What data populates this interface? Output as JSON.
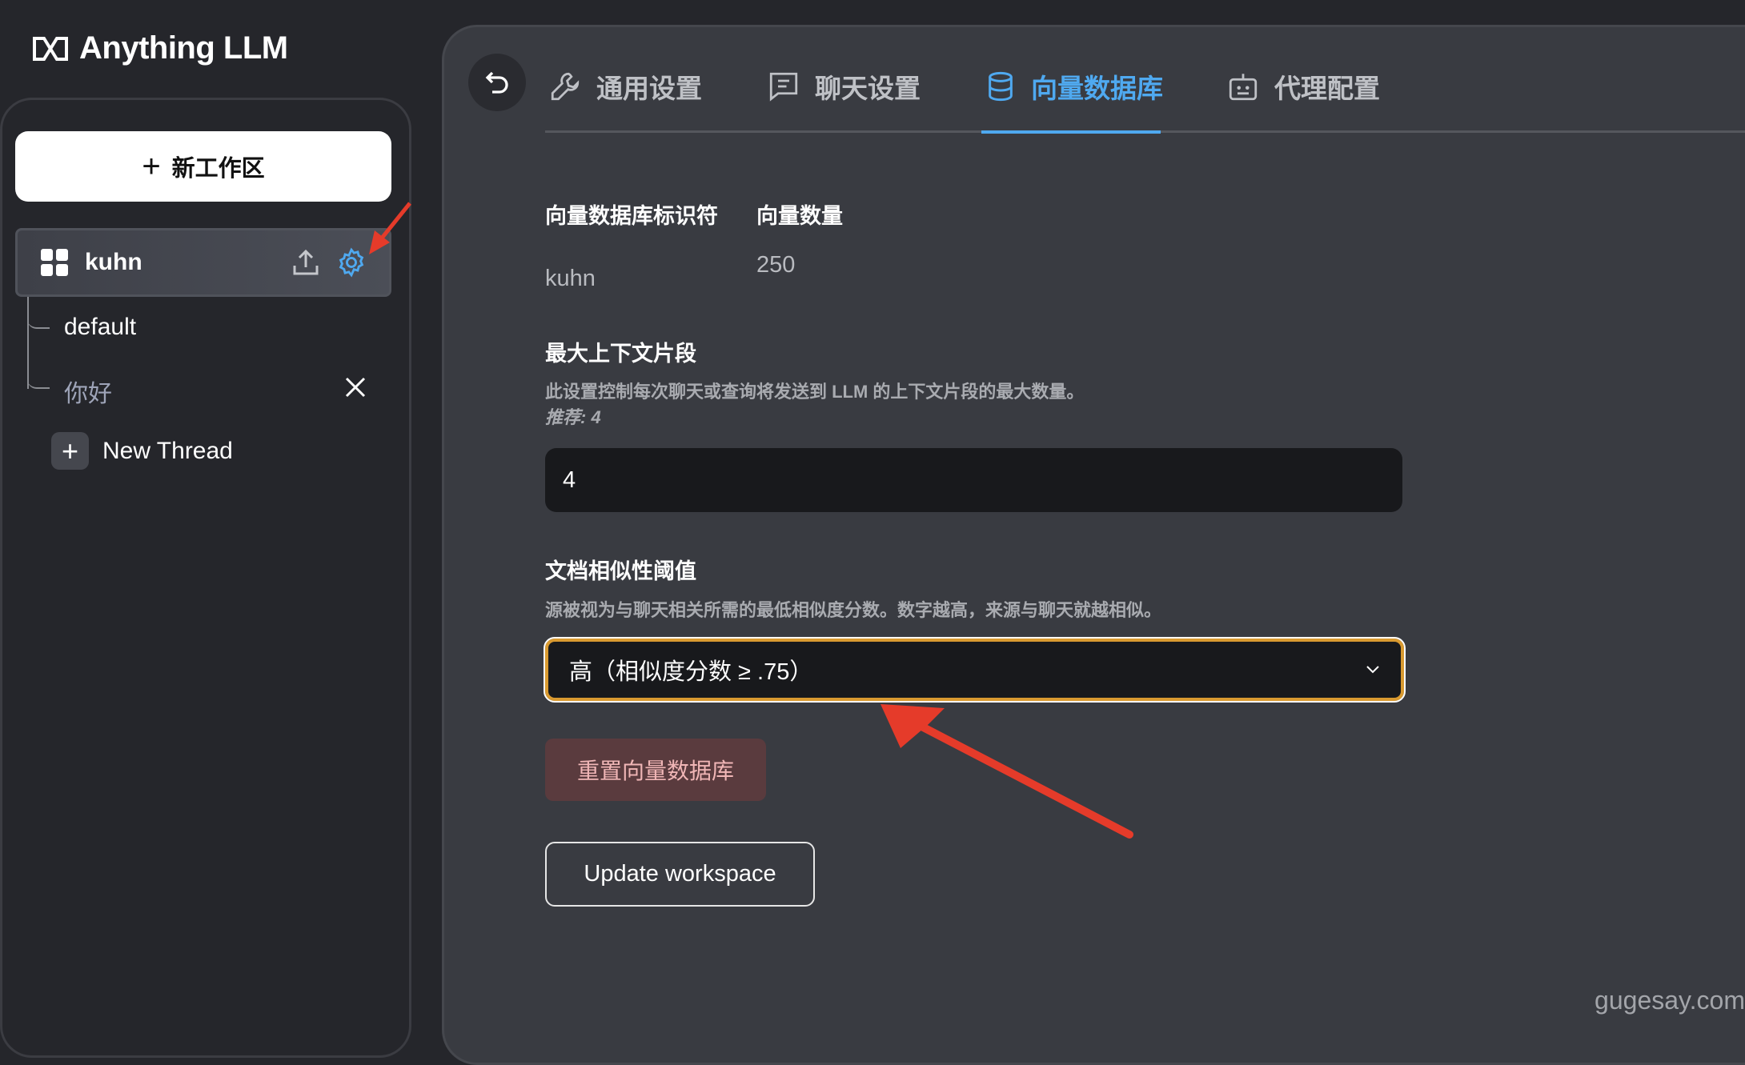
{
  "app": {
    "logo_text": "Anything LLM"
  },
  "sidebar": {
    "new_workspace_label": "新工作区",
    "workspace": {
      "name": "kuhn"
    },
    "threads": [
      {
        "label": "default"
      },
      {
        "label": "你好"
      }
    ],
    "new_thread_label": "New Thread"
  },
  "tabs": [
    {
      "label": "通用设置",
      "icon": "wrench-icon"
    },
    {
      "label": "聊天设置",
      "icon": "chat-icon"
    },
    {
      "label": "向量数据库",
      "icon": "database-icon",
      "active": true
    },
    {
      "label": "代理配置",
      "icon": "robot-icon"
    }
  ],
  "vector_db": {
    "identifier_label": "向量数据库标识符",
    "identifier_value": "kuhn",
    "count_label": "向量数量",
    "count_value": "250",
    "max_context_label": "最大上下文片段",
    "max_context_desc": "此设置控制每次聊天或查询将发送到 LLM 的上下文片段的最大数量。",
    "max_context_hint": "推荐: 4",
    "max_context_value": "4",
    "similarity_label": "文档相似性阈值",
    "similarity_desc": "源被视为与聊天相关所需的最低相似度分数。数字越高，来源与聊天就越相似。",
    "similarity_selected": "高（相似度分数 ≥ .75）",
    "reset_label": "重置向量数据库",
    "update_label": "Update workspace"
  },
  "colors": {
    "accent": "#4fa9f0",
    "focus_border": "#d99a30",
    "annotation_arrow": "#e53b2a"
  },
  "watermark": "gugesay.com"
}
